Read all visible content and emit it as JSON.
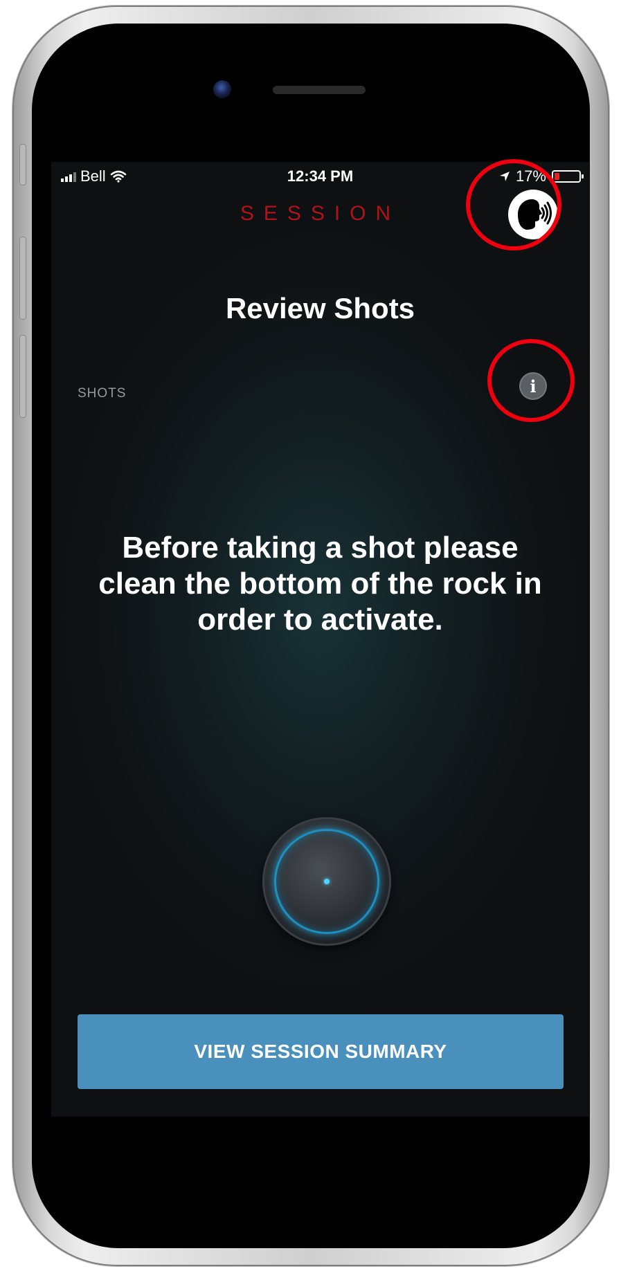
{
  "status_bar": {
    "carrier": "Bell",
    "time": "12:34 PM",
    "battery": "17%",
    "battery_level": 0.17
  },
  "header": {
    "title": "SESSION",
    "voice_icon": "speaking-head-icon"
  },
  "page": {
    "title": "Review Shots",
    "shots_label": "SHOTS",
    "info_icon": "info-icon",
    "info_glyph": "i",
    "instruction": "Before taking a shot please clean the bottom of the rock in order to activate."
  },
  "rock": {
    "icon": "curling-rock-sensor-icon",
    "accent_color": "#1e8fbf"
  },
  "actions": {
    "summary_label": "VIEW SESSION SUMMARY",
    "button_color": "#4a90bd"
  },
  "colors": {
    "title_red": "#b0141a",
    "annotation_red": "#f0000f"
  }
}
